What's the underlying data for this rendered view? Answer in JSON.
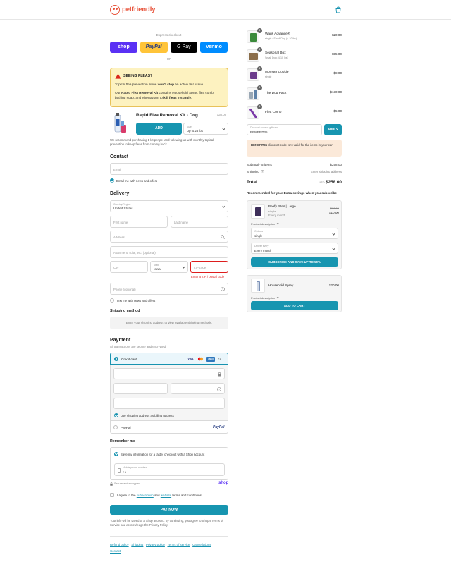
{
  "brand": {
    "name": "petfriendly"
  },
  "express": {
    "label": "Express checkout",
    "buttons": [
      {
        "label": "shop",
        "color": "#5a31f4",
        "text_color": "#ffffff"
      },
      {
        "label": "PayPal",
        "color": "#ffc439",
        "text_color": "#253b80"
      },
      {
        "label": "G Pay",
        "color": "#000000",
        "text_color": "#ffffff"
      },
      {
        "label": "venmo",
        "color": "#008cff",
        "text_color": "#ffffff"
      }
    ],
    "or": "OR"
  },
  "alert": {
    "title": "SEEING FLEAS?",
    "line1_a": "Topical flea prevention alone ",
    "line1_b": "won't stop",
    "line1_c": " an active flea issue.",
    "line2_a": "Our ",
    "line2_b": "Rapid Flea Removal Kit",
    "line2_c": " contains Household Spray, flea comb, bathing soap, and Nitenpyram to ",
    "line2_d": "kill fleas instantly",
    "line2_e": "."
  },
  "upsell": {
    "title": "Rapid Flea Removal Kit - Dog",
    "price": "$30.00",
    "add_label": "ADD",
    "size_label": "Size",
    "size_value": "Up to 25 lbs",
    "note": "We recommend purchasing 1 kit per pet and following up with monthly topical prevention to keep fleas from coming back."
  },
  "contact": {
    "heading": "Contact",
    "email_placeholder": "Email",
    "news_label": "Email me with news and offers"
  },
  "delivery": {
    "heading": "Delivery",
    "country_label": "Country/Region",
    "country_value": "United States",
    "first_name": "First name",
    "last_name": "Last name",
    "address": "Address",
    "apartment": "Apartment, suite, etc. (optional)",
    "city": "City",
    "state_label": "State",
    "state_value": "Iowa",
    "zip": "ZIP code",
    "zip_error": "Enter a ZIP / postal code",
    "phone": "Phone (optional)",
    "text_label": "Text me with news and offers"
  },
  "shipping": {
    "heading": "Shipping method",
    "placeholder": "Enter your shipping address to view available shipping methods."
  },
  "payment": {
    "heading": "Payment",
    "subtitle": "All transactions are secure and encrypted.",
    "credit_label": "Credit card",
    "card_brands": [
      "VISA",
      "MC",
      "AMEX"
    ],
    "more_brands": "+1",
    "billing_label": "Use shipping address as billing address",
    "paypal_label": "PayPal",
    "paypal_logo": "PayPal"
  },
  "remember": {
    "heading": "Remember me",
    "save_label": "Save my information for a faster checkout with a Shop account",
    "phone_label": "Mobile phone number",
    "phone_value": "+1",
    "secure": "Secure and encrypted",
    "shop": "shop"
  },
  "terms": {
    "a": "I agree to the ",
    "sub": "subscription",
    "b": " and ",
    "web": "website",
    "c": " terms and conditions"
  },
  "pay_now": "PAY NOW",
  "fine_print": {
    "a": "Your info will be saved to a Shop account. By continuing, you agree to Shop's ",
    "tos": "Terms of Service",
    "b": " and acknowledge the ",
    "pp": "Privacy Policy",
    "c": "."
  },
  "footer_links": [
    "Refund policy",
    "Shipping",
    "Privacy policy",
    "Terms of service",
    "Cancellations",
    "Contact"
  ],
  "summary": {
    "items": [
      {
        "qty": "1",
        "name": "Wags Advance®",
        "variant": "single / Small Dog (4-10 lbs)",
        "price": "$20.00",
        "color": "#3b8a3b"
      },
      {
        "qty": "1",
        "name": "Seasonal Box",
        "variant": "Small Dog (4-10 lbs)",
        "price": "$95.00",
        "color": "#8a6d4a"
      },
      {
        "qty": "1",
        "name": "Monster Cookie",
        "variant": "single",
        "price": "$8.00",
        "color": "#6a3a8a"
      },
      {
        "qty": "1",
        "name": "The Dog Pack",
        "variant": "",
        "price": "$130.00",
        "color": "#9aa8b5"
      },
      {
        "qty": "1",
        "name": "Flea Comb",
        "variant": "",
        "price": "$5.00",
        "color": "#7b3aa8"
      }
    ],
    "discount_label": "Discount code or gift card",
    "discount_value": "BENEFIT35",
    "apply": "APPLY",
    "discount_error_code": "BENEFIT35",
    "discount_error_text": " discount code isn't valid for the items in your cart",
    "subtotal_label": "Subtotal · 5 items",
    "subtotal_value": "$258.00",
    "shipping_label": "Shipping",
    "shipping_value": "Enter shipping address",
    "total_label": "Total",
    "currency": "USD",
    "total_value": "$258.00",
    "rec_heading": "Recommended for you: Extra savings when you subscribe",
    "rec1": {
      "name": "Beefy Bites | Large",
      "variant": "single",
      "freq": "Every month",
      "old_price": "$20.00",
      "price": "$10.00",
      "desc": "Product description",
      "options_label": "Options",
      "options_value": "single",
      "delivery_label": "Deliver every",
      "delivery_value": "Every month",
      "cta": "SUBSCRIBE AND SAVE UP TO 50%"
    },
    "rec2": {
      "name": "Household Spray",
      "price": "$20.00",
      "desc": "Product description",
      "cta": "ADD TO CART"
    }
  },
  "colors": {
    "accent": "#1795b0",
    "brand": "#e8553d",
    "error": "#dd1d1d",
    "alert_bg": "#fdf2c0"
  }
}
